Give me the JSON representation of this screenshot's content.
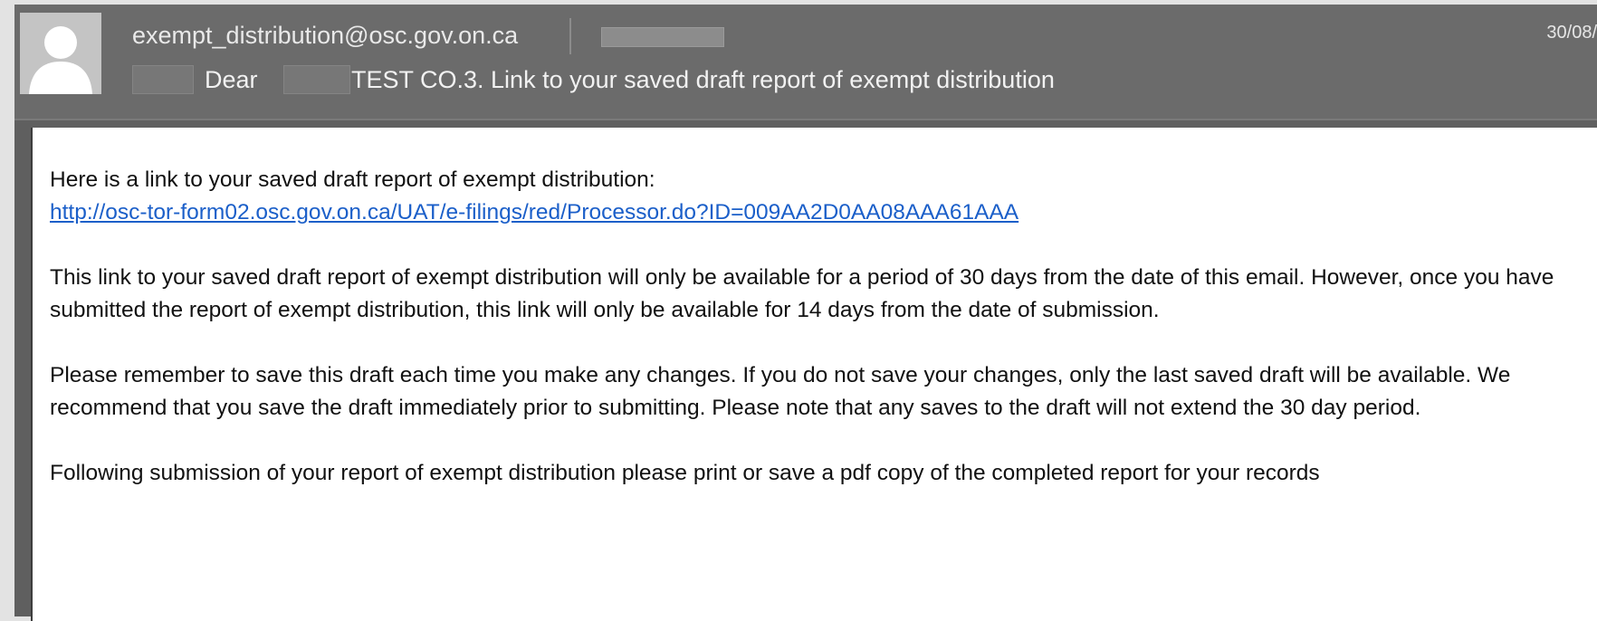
{
  "header": {
    "sender": "exempt_distribution@osc.gov.on.ca",
    "date": "30/08/",
    "subject_prefix": "Dear",
    "subject_main": "TEST CO.3.  Link to your saved draft report of exempt distribution"
  },
  "body": {
    "intro": "Here is a link to your saved draft report of exempt distribution:",
    "link": "http://osc-tor-form02.osc.gov.on.ca/UAT/e-filings/red/Processor.do?ID=009AA2D0AA08AAA61AAA",
    "paragraph_availability": "This link to your saved draft report of exempt distribution will only be available for a period of 30 days from the date of this email.  However, once you have submitted the report of exempt distribution, this link will only be available for 14 days from the date of submission.",
    "paragraph_save": "Please remember to save this draft each time you make any changes.  If you do not save your changes, only the last saved draft will be available.  We recommend that you save the draft immediately prior to submitting.  Please note that any saves to the draft will not extend the 30 day period.",
    "paragraph_followup": "Following submission of your report of exempt distribution please print or save a pdf copy of the completed report for your records"
  },
  "icons": {
    "avatar": "person-placeholder-icon"
  },
  "colors": {
    "header_bg": "#6b6b6b",
    "link": "#1b5fc9",
    "body_bg": "#ffffff"
  }
}
